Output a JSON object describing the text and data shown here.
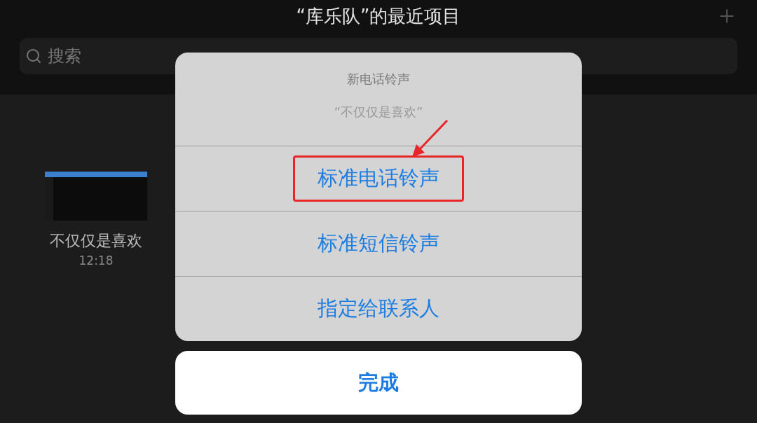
{
  "nav_bar": {
    "title": "“库乐队”的最近项目",
    "search": {
      "placeholder": "搜索"
    }
  },
  "projects": [
    {
      "name": "不仅仅是喜欢",
      "time": "12:18"
    }
  ],
  "action_sheet": {
    "title": "新电话铃声",
    "message": "“不仅仅是喜欢”",
    "actions": [
      {
        "label": "标准电话铃声",
        "highlighted": true
      },
      {
        "label": "标准短信铃声",
        "highlighted": false
      },
      {
        "label": "指定给联系人",
        "highlighted": false
      }
    ],
    "done_button": "完成"
  }
}
